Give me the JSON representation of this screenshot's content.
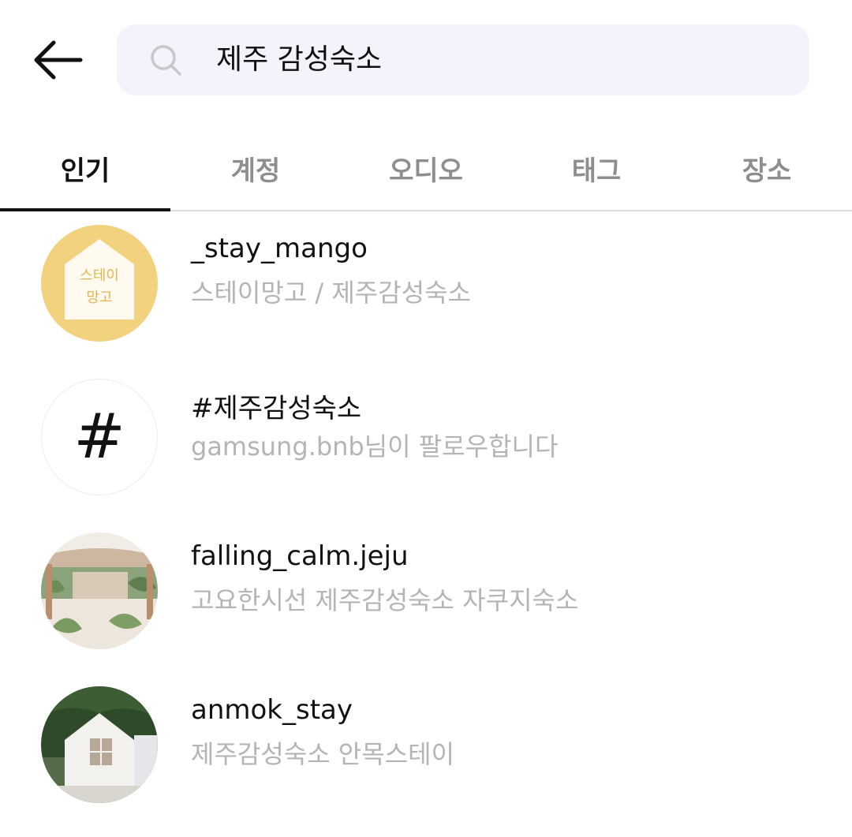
{
  "search": {
    "query": "제주 감성숙소"
  },
  "tabs": [
    {
      "label": "인기",
      "active": true
    },
    {
      "label": "계정"
    },
    {
      "label": "오디오"
    },
    {
      "label": "태그"
    },
    {
      "label": "장소"
    }
  ],
  "results": [
    {
      "name": "_stay_mango",
      "subtitle": "스테이망고 / 제주감성숙소",
      "avatar_text": [
        "스테이",
        "망고"
      ]
    },
    {
      "name": "#제주감성숙소",
      "subtitle": "gamsung.bnb님이 팔로우합니다",
      "avatar_symbol": "#"
    },
    {
      "name": "falling_calm.jeju",
      "subtitle": "고요한시선 제주감성숙소 자쿠지숙소"
    },
    {
      "name": "anmok_stay",
      "subtitle": "제주감성숙소 안목스테이"
    }
  ],
  "colors": {
    "search_bg": "#f3f4fb",
    "mango_yellow": "#f3d27f",
    "secondary_text": "#b4b4b4"
  }
}
